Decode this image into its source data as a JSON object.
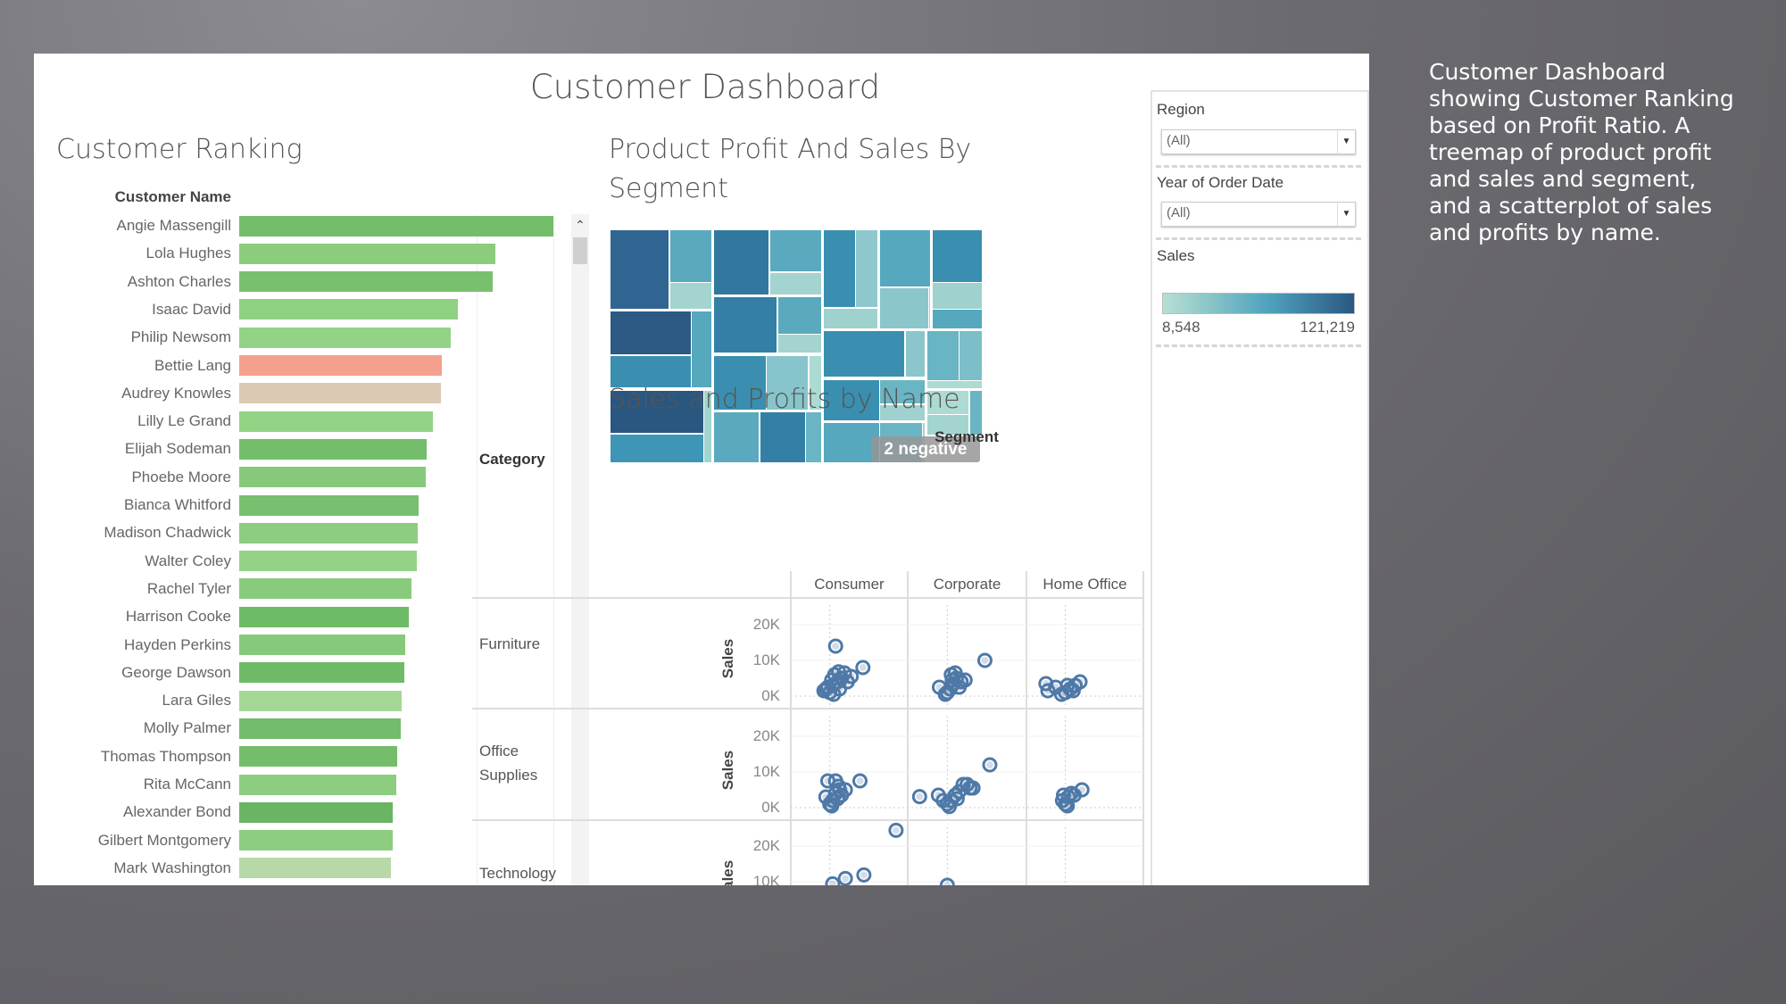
{
  "dashboard": {
    "title": "Customer Dashboard"
  },
  "ranking": {
    "title": "Customer Ranking",
    "header": "Customer Name",
    "customers": [
      {
        "name": "Angie Massengill",
        "value": 100,
        "color": "#74bd6b"
      },
      {
        "name": "Lola Hughes",
        "value": 81.5,
        "color": "#8bcc7d"
      },
      {
        "name": "Ashton Charles",
        "value": 80.8,
        "color": "#79c06e"
      },
      {
        "name": "Isaac David",
        "value": 69.6,
        "color": "#8fd182"
      },
      {
        "name": "Philip Newsom",
        "value": 67.4,
        "color": "#93d385"
      },
      {
        "name": "Bettie Lang",
        "value": 64.5,
        "color": "#f4a08f"
      },
      {
        "name": "Audrey Knowles",
        "value": 64.1,
        "color": "#dbc9b3"
      },
      {
        "name": "Lilly Le Grand",
        "value": 61.6,
        "color": "#93d385"
      },
      {
        "name": "Elijah Sodeman",
        "value": 59.8,
        "color": "#74bd6b"
      },
      {
        "name": "Phoebe Moore",
        "value": 59.4,
        "color": "#86c97b"
      },
      {
        "name": "Bianca Whitford",
        "value": 57.2,
        "color": "#78bf6f"
      },
      {
        "name": "Madison Chadwick",
        "value": 56.9,
        "color": "#8ccd80"
      },
      {
        "name": "Walter Coley",
        "value": 56.5,
        "color": "#94d287"
      },
      {
        "name": "Rachel Tyler",
        "value": 54.7,
        "color": "#89cb7d"
      },
      {
        "name": "Harrison Cooke",
        "value": 54.0,
        "color": "#6fba67"
      },
      {
        "name": "Hayden Perkins",
        "value": 52.9,
        "color": "#86c97b"
      },
      {
        "name": "George Dawson",
        "value": 52.5,
        "color": "#6fba67"
      },
      {
        "name": "Lara Giles",
        "value": 51.8,
        "color": "#a4d897"
      },
      {
        "name": "Molly Palmer",
        "value": 51.4,
        "color": "#73bc6b"
      },
      {
        "name": "Thomas Thompson",
        "value": 50.4,
        "color": "#74bd6b"
      },
      {
        "name": "Rita McCann",
        "value": 50.0,
        "color": "#8ccd80"
      },
      {
        "name": "Alexander Bond",
        "value": 48.9,
        "color": "#6ab563"
      },
      {
        "name": "Gilbert Montgomery",
        "value": 48.9,
        "color": "#8ccd80"
      },
      {
        "name": "Mark Washington",
        "value": 48.2,
        "color": "#b7d9a9"
      }
    ]
  },
  "treemap": {
    "title_line1": "Product Profit And Sales By",
    "title_line2": "Segment",
    "badge": "2 negative"
  },
  "chart_data": {
    "type": "scatter",
    "title": "Sales and Profits by Name",
    "column_header": "Segment",
    "row_header": "Category",
    "ylabel": "Sales",
    "columns": [
      "Consumer",
      "Corporate",
      "Home Office"
    ],
    "rows": [
      "Furniture",
      "Office Supplies",
      "Technology"
    ],
    "row_labels": [
      [
        "Furniture"
      ],
      [
        "Office",
        "Supplies"
      ],
      [
        "Technology"
      ]
    ],
    "yticks": [
      "20K",
      "10K",
      "0K"
    ],
    "ylim": [
      0,
      20000
    ],
    "marker_color": "#4e79a7",
    "panels": [
      {
        "row": "Furniture",
        "column": "Consumer",
        "points": [
          [
            600,
            14000
          ],
          [
            3400,
            8000
          ],
          [
            0,
            1000
          ],
          [
            -400,
            2000
          ],
          [
            300,
            3000
          ],
          [
            800,
            4000
          ],
          [
            1200,
            5000
          ],
          [
            500,
            6000
          ],
          [
            1500,
            6500
          ],
          [
            2200,
            5500
          ],
          [
            -200,
            2500
          ],
          [
            1000,
            2000
          ],
          [
            400,
            500
          ],
          [
            1800,
            4000
          ],
          [
            900,
            6800
          ],
          [
            -600,
            1500
          ],
          [
            200,
            4500
          ]
        ]
      },
      {
        "row": "Furniture",
        "column": "Corporate",
        "points": [
          [
            3800,
            10000
          ],
          [
            0,
            1000
          ],
          [
            300,
            2000
          ],
          [
            -800,
            2500
          ],
          [
            600,
            3500
          ],
          [
            900,
            5000
          ],
          [
            1400,
            4000
          ],
          [
            1800,
            4500
          ],
          [
            400,
            6000
          ],
          [
            800,
            6500
          ],
          [
            -200,
            500
          ],
          [
            1200,
            2500
          ],
          [
            500,
            4500
          ]
        ]
      },
      {
        "row": "Furniture",
        "column": "Home Office",
        "points": [
          [
            -2000,
            3500
          ],
          [
            -1800,
            1500
          ],
          [
            -1000,
            2500
          ],
          [
            0,
            1000
          ],
          [
            500,
            2000
          ],
          [
            1000,
            3000
          ],
          [
            1500,
            4000
          ],
          [
            -400,
            500
          ],
          [
            800,
            1500
          ],
          [
            200,
            3000
          ]
        ]
      },
      {
        "row": "Office Supplies",
        "column": "Consumer",
        "points": [
          [
            3100,
            7500
          ],
          [
            0,
            1000
          ],
          [
            -400,
            3000
          ],
          [
            300,
            2000
          ],
          [
            600,
            4000
          ],
          [
            1000,
            5000
          ],
          [
            -200,
            7500
          ],
          [
            600,
            7500
          ],
          [
            900,
            6000
          ],
          [
            1600,
            5000
          ],
          [
            200,
            500
          ],
          [
            800,
            2500
          ],
          [
            1200,
            3500
          ]
        ]
      },
      {
        "row": "Office Supplies",
        "column": "Corporate",
        "points": [
          [
            -2800,
            3100
          ],
          [
            4300,
            12000
          ],
          [
            -900,
            3500
          ],
          [
            0,
            1000
          ],
          [
            400,
            2000
          ],
          [
            800,
            3500
          ],
          [
            1200,
            4500
          ],
          [
            1600,
            6500
          ],
          [
            2000,
            6500
          ],
          [
            2300,
            5500
          ],
          [
            2600,
            5500
          ],
          [
            200,
            300
          ],
          [
            1000,
            2500
          ],
          [
            -400,
            2000
          ]
        ]
      },
      {
        "row": "Office Supplies",
        "column": "Home Office",
        "points": [
          [
            1700,
            5000
          ],
          [
            0,
            1000
          ],
          [
            -300,
            2000
          ],
          [
            300,
            3000
          ],
          [
            600,
            4000
          ],
          [
            900,
            3500
          ],
          [
            200,
            500
          ],
          [
            -200,
            3500
          ]
        ]
      },
      {
        "row": "Technology",
        "column": "Consumer",
        "points": [
          [
            6800,
            24400
          ],
          [
            3500,
            11900
          ],
          [
            1600,
            10900
          ],
          [
            300,
            9400
          ]
        ]
      },
      {
        "row": "Technology",
        "column": "Corporate",
        "points": [
          [
            0,
            9000
          ]
        ]
      },
      {
        "row": "Technology",
        "column": "Home Office",
        "points": []
      }
    ]
  },
  "filters": {
    "region": {
      "label": "Region",
      "value": "(All)"
    },
    "year": {
      "label": "Year of Order Date",
      "value": "(All)"
    },
    "sales_legend": {
      "label": "Sales",
      "min": "8,548",
      "max": "121,219",
      "color_low": "#b7e0d3",
      "color_high": "#2a5783"
    }
  },
  "description": {
    "lines": [
      "Customer Dashboard",
      "showing Customer Ranking",
      "based on Profit Ratio. A",
      "treemap of product profit",
      "and sales and segment,",
      "and a scatterplot of sales",
      "and profits by name."
    ]
  }
}
